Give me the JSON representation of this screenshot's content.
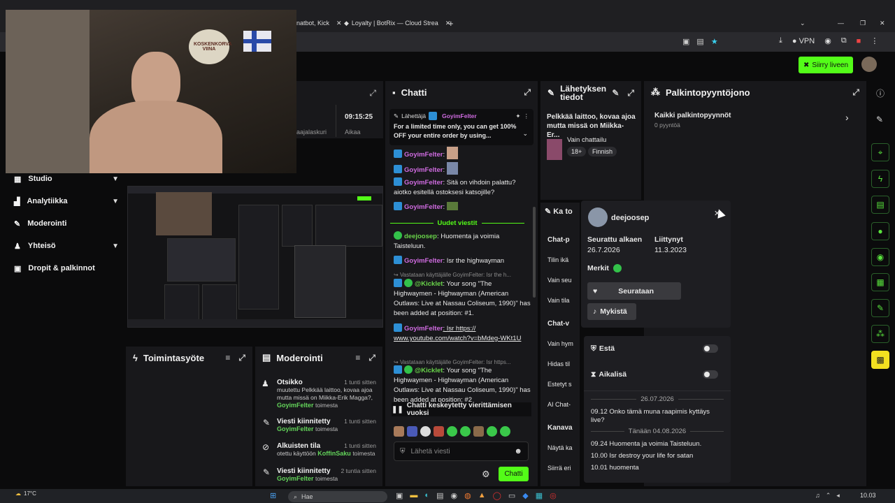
{
  "browser": {
    "tabs": [
      {
        "label": "natbot, Kick"
      },
      {
        "label": "Loyalty | BotRix — Cloud Strea"
      }
    ],
    "vpn_label": "VPN"
  },
  "appbar": {
    "go_live_label": "Siirry liveen"
  },
  "nav": {
    "items": [
      {
        "label": "Studio"
      },
      {
        "label": "Analytiikka"
      },
      {
        "label": "Moderointi"
      },
      {
        "label": "Yhteisö"
      },
      {
        "label": "Dropit & palkinnot"
      }
    ]
  },
  "stats": {
    "time": "09:15:25",
    "label1": "aajalaskuri",
    "label2": "Aikaa"
  },
  "chat": {
    "title": "Chatti",
    "pinned": {
      "by": "Lähettäjä",
      "user": "GoyimFelter",
      "text": "For a limited time only, you can get 100% OFF your entire order by using..."
    },
    "lines": [
      {
        "user": "GoyimFelter",
        "text": ":"
      },
      {
        "user": "GoyimFelter",
        "text": ":"
      },
      {
        "user": "GoyimFelter",
        "text": ": Sitä on vihdoin palattu? aiotko esitellä ostoksesi katsojille?"
      },
      {
        "user": "GoyimFelter",
        "text": ":"
      }
    ],
    "new_messages": "Uudet viestit",
    "lines2": [
      {
        "user": "deejoosep",
        "text": ": Huomenta ja voimia Taisteluun."
      },
      {
        "user": "GoyimFelter",
        "text": ": Isr the highwayman"
      },
      {
        "sys": "Vastataan käyttäjälle GoyimFelter: Isr the h..."
      },
      {
        "user": "@Kicklet",
        "text": ": Your song \"The Highwaymen - Highwayman (American Outlaws: Live at Nassau Coliseum, 1990)\" has been added at position: #1."
      },
      {
        "user": "GoyimFelter",
        "text": ": Isr https:// www.youtube.com/watch?v=bMdeg-WKt1U"
      },
      {
        "sys": "Vastataan käyttäjälle GoyimFelter: Isr https..."
      },
      {
        "user": "@Kicklet",
        "text": ": Your song \"The Highwaymen - Highwayman (American Outlaws: Live at Nassau Coliseum, 1990)\" has been added at position: #2"
      }
    ],
    "paused": "Chatti keskeytetty vierittämisen vuoksi",
    "input_placeholder": "Lähetä viesti",
    "send_label": "Chatti"
  },
  "stream_info": {
    "title": "Lähetyksen tiedot",
    "description": "Pelkkää laittoo, kovaa ajoa mutta missä on Miikka-Er...",
    "category": "Vain chattailu",
    "tags": [
      "18+",
      "Finnish"
    ]
  },
  "rewards": {
    "title": "Palkintopyyntöjono",
    "all_label": "Kaikki palkintopyynnöt",
    "count": "0 pyyntöä"
  },
  "activity": {
    "title": "Toimintasyöte"
  },
  "moderation": {
    "title": "Moderointi",
    "rows": [
      {
        "title": "Otsikko",
        "time": "1 tunti sitten",
        "line1": "muutettu Pelkkää laittoo, kovaa ajoa mutta missä on Miikka-Erik Magga?,",
        "user": "GoyimFelter",
        "suffix": "toimesta"
      },
      {
        "title": "Viesti kiinnitetty",
        "time": "1 tunti sitten",
        "user": "GoyimFelter",
        "suffix": "toimesta"
      },
      {
        "title": "Alkuisten tila",
        "time": "1 tunti sitten",
        "line1": "otettu käyttöön",
        "user": "KoffinSaku",
        "suffix": "toimesta"
      },
      {
        "title": "Viesti kiinnitetty",
        "time": "2 tuntia sitten",
        "user": "GoyimFelter",
        "suffix": "toimesta"
      }
    ]
  },
  "chat_settings": {
    "title": "Ka to",
    "rows": [
      "Chat-p",
      "Tilin ikä",
      "Vain seu",
      "Vain tila",
      "Chat-v",
      "Vain hym",
      "Hidas til",
      "Estetyt s",
      "AI Chat-",
      "Kanava",
      "Näytä ka",
      "Siirrä eri"
    ]
  },
  "user_card": {
    "username": "deejoosep",
    "followed_label": "Seurattu alkaen",
    "followed_date": "26.7.2026",
    "joined_label": "Liittynyt",
    "joined_date": "11.3.2023",
    "badges_label": "Merkit",
    "follow_btn": "Seurataan",
    "mute_btn": "Mykistä",
    "ban_label": "Estä",
    "timeout_label": "Aikalisä",
    "history": [
      {
        "date": "26.07.2026",
        "messages": [
          "09.12 Onko tämä muna raapimis kyttäys live?"
        ]
      },
      {
        "date": "Tänään 04.08.2026",
        "messages": [
          "09.24 Huomenta ja voimia Taisteluun.",
          "10.00 Isr destroy your life for satan",
          "10.01 huomenta"
        ]
      }
    ]
  },
  "taskbar": {
    "temp": "17°C",
    "search": "Hae",
    "clock": "10.03"
  },
  "webcam_overlay": {
    "sign": "KOSKENKORVA VIINA"
  },
  "colors": {
    "accent": "#53fc18",
    "panel": "#18181b",
    "bg": "#0b0b0c"
  }
}
